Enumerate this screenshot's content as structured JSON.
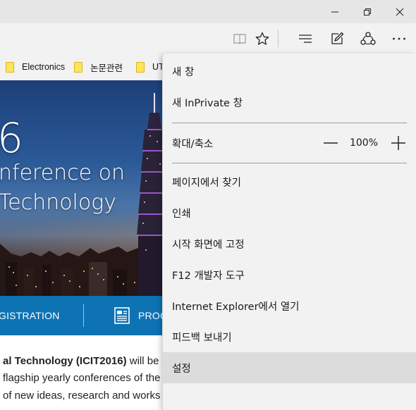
{
  "window": {
    "minimize_icon": "minimize-icon",
    "restore_icon": "restore-icon",
    "close_icon": "close-icon"
  },
  "toolbar": {
    "icons": [
      "reading-view-icon",
      "favorites-star-icon",
      "hub-icon",
      "web-note-icon",
      "share-icon",
      "more-icon"
    ]
  },
  "favorites_bar": {
    "items": [
      {
        "label": "Electronics",
        "icon": "folder-icon"
      },
      {
        "label": "논문관련",
        "icon": "folder-icon"
      },
      {
        "label": "UT",
        "icon": "folder-icon"
      }
    ]
  },
  "hero": {
    "big_number": "6",
    "line1": "nference on",
    "line2": "Technology"
  },
  "nav_strip": {
    "registration": "GISTRATION",
    "program": "PROG"
  },
  "content": {
    "line1_bold": "al Technology (ICIT2016)",
    "line1_rest": " will be he",
    "line2": "flagship yearly conferences of the I",
    "line3": "of new ideas, research and works in progress within"
  },
  "menu": {
    "new_window": "새 창",
    "new_inprivate": "새 InPrivate 창",
    "zoom_label": "확대/축소",
    "zoom_value": "100%",
    "find_on_page": "페이지에서 찾기",
    "print": "인쇄",
    "pin_to_start": "시작 화면에 고정",
    "dev_tools": "F12 개발자 도구",
    "open_ie": "Internet Explorer에서 열기",
    "send_feedback": "피드백 보내기",
    "settings": "설정"
  },
  "colors": {
    "accent": "#0d73b3",
    "menu_bg": "#f2f2f2",
    "menu_hover": "#dcdcdc",
    "folder": "#ffe45c"
  }
}
